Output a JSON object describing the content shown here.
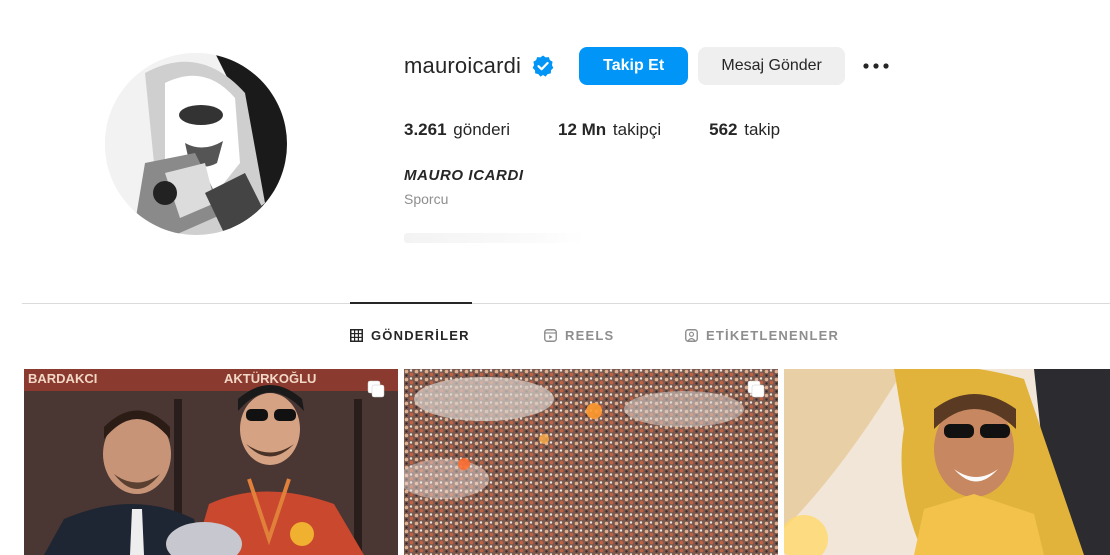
{
  "profile": {
    "username": "mauroicardi",
    "verified_icon": "verified-badge-icon",
    "follow_label": "Takip Et",
    "message_label": "Mesaj Gönder",
    "more_icon": "more-options-icon",
    "full_name": "MAURO ICARDI",
    "category": "Sporcu"
  },
  "stats": {
    "posts_value": "3.261",
    "posts_label": "gönderi",
    "followers_value": "12 Mn",
    "followers_label": "takipçi",
    "following_value": "562",
    "following_label": "takip"
  },
  "tabs": [
    {
      "label": "GÖNDERİLER",
      "icon": "grid-icon",
      "active": true
    },
    {
      "label": "REELS",
      "icon": "reels-icon",
      "active": false
    },
    {
      "label": "ETİKETLENENLER",
      "icon": "tagged-icon",
      "active": false
    }
  ],
  "posts": [
    {
      "icon": "multiple-photos-icon",
      "banner_left": "BARDAKCI",
      "banner_right": "AKTÜRKOĞLU"
    },
    {
      "icon": "multiple-photos-icon"
    },
    {}
  ],
  "colors": {
    "accent": "#0095f6",
    "secondary_button": "#efefef",
    "text": "#262626",
    "muted": "#8e8e8e",
    "divider": "#dbdbdb"
  }
}
